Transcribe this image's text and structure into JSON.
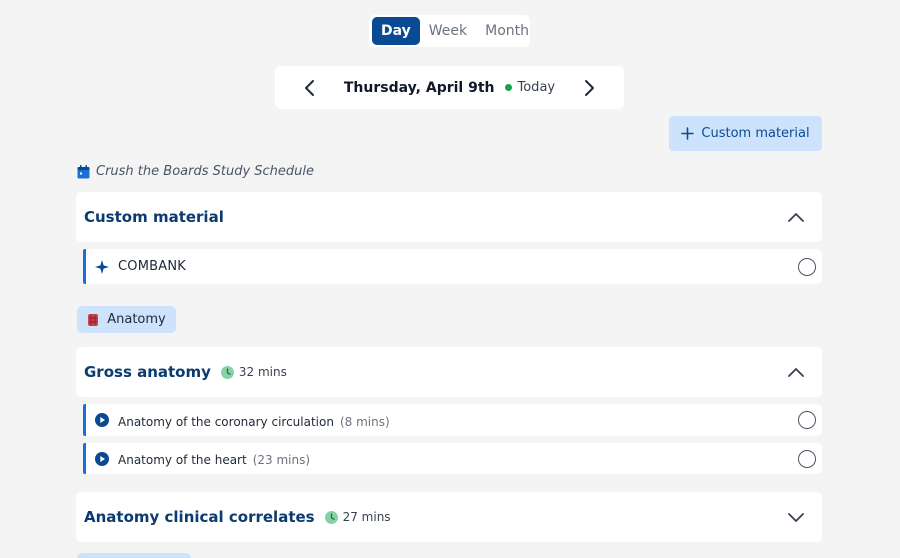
{
  "view_tabs": [
    {
      "label": "Day",
      "active": true
    },
    {
      "label": "Week",
      "active": false
    },
    {
      "label": "Month",
      "active": false
    }
  ],
  "date_nav": {
    "date": "Thursday, April 9th",
    "today_label": "Today",
    "today_dot_color": "#16a34a",
    "prev_icon": "chevron-left-icon",
    "next_icon": "chevron-right-icon"
  },
  "add_button": {
    "icon": "plus-icon",
    "label": "Custom material"
  },
  "schedule": {
    "icon": "calendar-icon",
    "title": "Crush the Boards Study Schedule"
  },
  "sections": [
    {
      "title": "Custom material",
      "expanded": true,
      "tasks": [
        {
          "icon": "sparkle-icon",
          "name": "COMBANK"
        }
      ]
    },
    {
      "title": "Gross anatomy",
      "duration": "32 mins",
      "expanded": true,
      "tasks": [
        {
          "icon": "play-icon",
          "name": "Anatomy of the coronary circulation",
          "duration": "(8 mins)"
        },
        {
          "icon": "play-icon",
          "name": "Anatomy of the heart",
          "duration": "(23 mins)"
        }
      ]
    },
    {
      "title": "Anatomy clinical correlates",
      "duration": "27 mins",
      "expanded": false
    }
  ],
  "subject_chip": {
    "icon": "anatomy-icon",
    "label": "Anatomy"
  },
  "colors": {
    "brand": "#0a4a93",
    "section_title": "#0b3b6f",
    "accent_light": "#cde3fb",
    "task_border": "#1d6fd8",
    "clock_green": "#16a34a"
  }
}
